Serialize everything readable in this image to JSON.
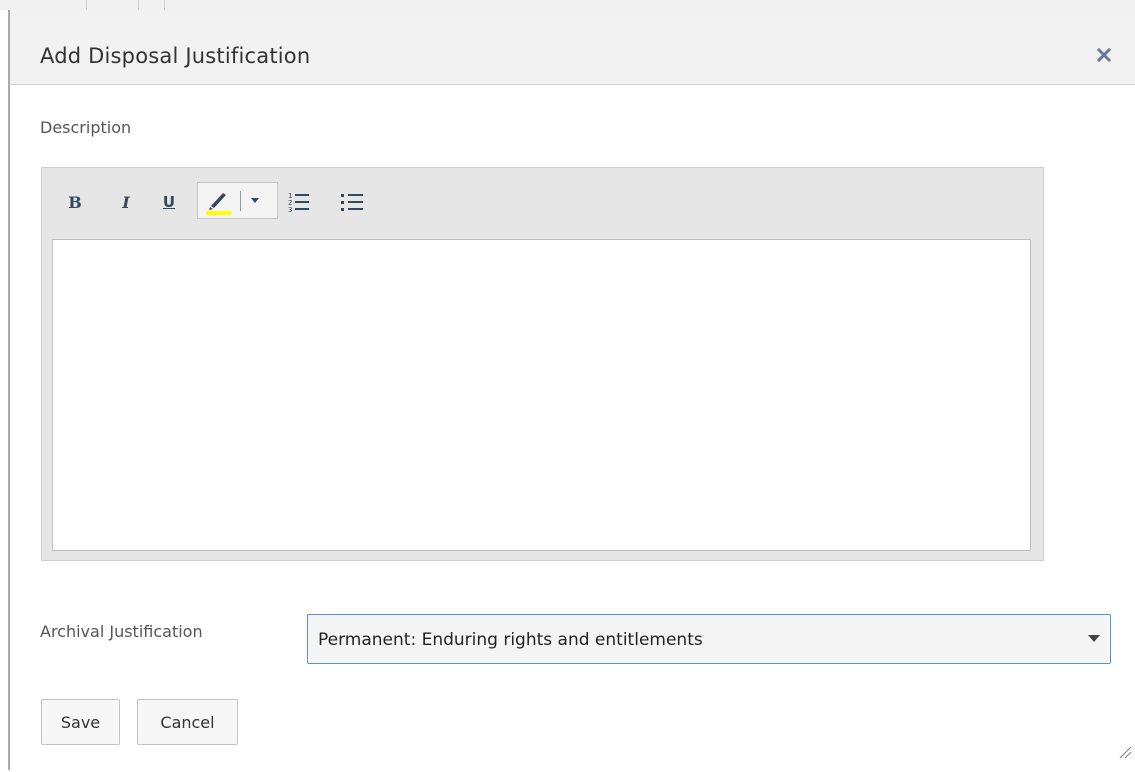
{
  "dialog": {
    "title": "Add Disposal Justification",
    "close_icon": "close-icon"
  },
  "description": {
    "label": "Description",
    "editor_value": "",
    "toolbar": {
      "bold_label": "B",
      "italic_label": "I",
      "underline_label": "U",
      "highlight_icon": "highlighter-icon",
      "highlight_color": "#ffff00",
      "dropdown_icon": "caret-down-icon",
      "ordered_list_icon": "ordered-list-icon",
      "unordered_list_icon": "unordered-list-icon"
    }
  },
  "archival": {
    "label": "Archival Justification",
    "selected": "Permanent: Enduring rights and entitlements"
  },
  "actions": {
    "save_label": "Save",
    "cancel_label": "Cancel"
  },
  "colors": {
    "accent_border": "#5b8fd6",
    "title_bar": "#f2f2f2",
    "editor_chrome": "#e6e6e6"
  }
}
